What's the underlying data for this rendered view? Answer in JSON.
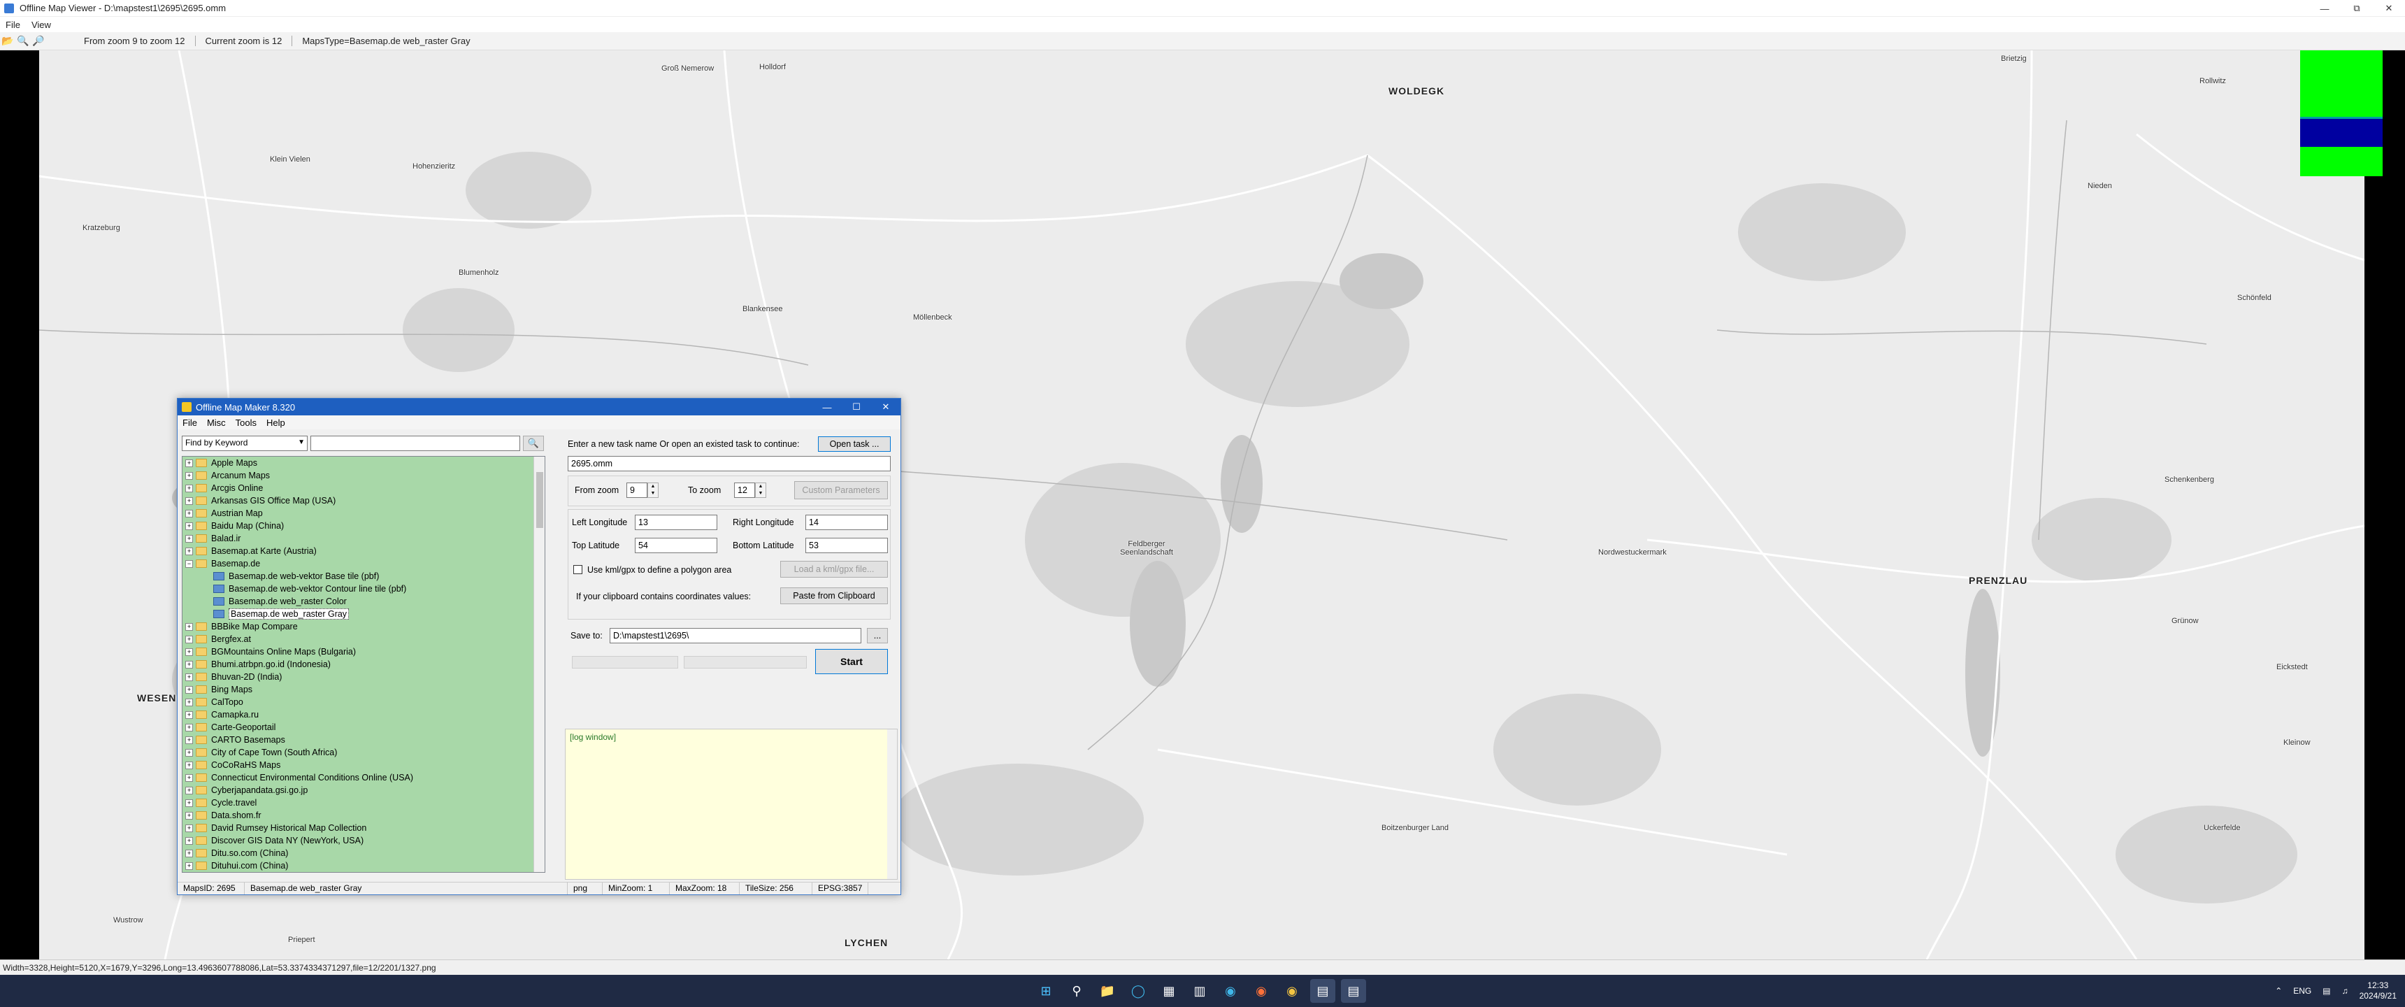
{
  "viewer": {
    "title": "Offline Map Viewer - D:\\mapstest1\\2695\\2695.omm",
    "menu": [
      "File",
      "View"
    ],
    "toolbar": {
      "zoom_range": "From zoom 9 to zoom 12",
      "current_zoom": "Current zoom is 12",
      "maps_type": "MapsType=Basemap.de web_raster Gray"
    },
    "status": "Width=3328,Height=5120,X=1679,Y=3296,Long=13.4963607788086,Lat=53.3374334371297,file=12/2201/1327.png",
    "colors": {
      "indicator_green": "#00ff00",
      "indicator_blue": "#0000a0"
    }
  },
  "map": {
    "places": [
      {
        "name": "WOLDEGK",
        "big": true
      },
      {
        "name": "PRENZLAU",
        "big": true
      },
      {
        "name": "WESENBERG",
        "big": true
      },
      {
        "name": "LYCHEN",
        "big": true
      },
      {
        "name": "Groß Nemerow",
        "big": false
      },
      {
        "name": "Holldorf",
        "big": false
      },
      {
        "name": "Kratzeburg",
        "big": false
      },
      {
        "name": "Klein Vielen",
        "big": false
      },
      {
        "name": "Hohenzieritz",
        "big": false
      },
      {
        "name": "Blumenholz",
        "big": false
      },
      {
        "name": "Blankensee",
        "big": false
      },
      {
        "name": "Möllenbeck",
        "big": false
      },
      {
        "name": "Feldberger Seenlandschaft",
        "big": false
      },
      {
        "name": "Nordwestuckermark",
        "big": false
      },
      {
        "name": "Boitzenburger Land",
        "big": false
      },
      {
        "name": "Wustrow",
        "big": false
      },
      {
        "name": "Priepert",
        "big": false
      },
      {
        "name": "Brietzig",
        "big": false
      },
      {
        "name": "Rollwitz",
        "big": false
      },
      {
        "name": "Nieden",
        "big": false
      },
      {
        "name": "Schönfeld",
        "big": false
      },
      {
        "name": "Schenkenberg",
        "big": false
      },
      {
        "name": "Grünow",
        "big": false
      },
      {
        "name": "Eickstedt",
        "big": false
      },
      {
        "name": "Uckerfelde",
        "big": false
      },
      {
        "name": "Kleinow",
        "big": false
      }
    ]
  },
  "dialog": {
    "title": "Offline Map Maker 8.320",
    "menu": [
      "File",
      "Misc",
      "Tools",
      "Help"
    ],
    "find": {
      "mode": "Find by Keyword",
      "query": ""
    },
    "tree": [
      {
        "label": "Apple Maps",
        "expanded": false
      },
      {
        "label": "Arcanum Maps",
        "expanded": false
      },
      {
        "label": "Arcgis Online",
        "expanded": false
      },
      {
        "label": "Arkansas GIS Office Map (USA)",
        "expanded": false
      },
      {
        "label": "Austrian Map",
        "expanded": false
      },
      {
        "label": "Baidu Map (China)",
        "expanded": false
      },
      {
        "label": "Balad.ir",
        "expanded": false
      },
      {
        "label": "Basemap.at Karte (Austria)",
        "expanded": false
      },
      {
        "label": "Basemap.de",
        "expanded": true,
        "children": [
          {
            "label": "Basemap.de web-vektor Base tile (pbf)"
          },
          {
            "label": "Basemap.de web-vektor Contour line tile (pbf)"
          },
          {
            "label": "Basemap.de web_raster Color"
          },
          {
            "label": "Basemap.de web_raster Gray",
            "selected": true
          }
        ]
      },
      {
        "label": "BBBike Map Compare",
        "expanded": false
      },
      {
        "label": "Bergfex.at",
        "expanded": false
      },
      {
        "label": "BGMountains Online Maps (Bulgaria)",
        "expanded": false
      },
      {
        "label": "Bhumi.atrbpn.go.id (Indonesia)",
        "expanded": false
      },
      {
        "label": "Bhuvan-2D (India)",
        "expanded": false
      },
      {
        "label": "Bing Maps",
        "expanded": false
      },
      {
        "label": "CalTopo",
        "expanded": false
      },
      {
        "label": "Camapka.ru",
        "expanded": false
      },
      {
        "label": "Carte-Geoportail",
        "expanded": false
      },
      {
        "label": "CARTO Basemaps",
        "expanded": false
      },
      {
        "label": "City of Cape Town (South Africa)",
        "expanded": false
      },
      {
        "label": "CoCoRaHS Maps",
        "expanded": false
      },
      {
        "label": "Connecticut Environmental Conditions Online (USA)",
        "expanded": false
      },
      {
        "label": "Cyberjapandata.gsi.go.jp",
        "expanded": false
      },
      {
        "label": "Cycle.travel",
        "expanded": false
      },
      {
        "label": "Data.shom.fr",
        "expanded": false
      },
      {
        "label": "David Rumsey Historical Map Collection",
        "expanded": false
      },
      {
        "label": "Discover GIS Data NY (NewYork, USA)",
        "expanded": false
      },
      {
        "label": "Ditu.so.com (China)",
        "expanded": false
      },
      {
        "label": "Dituhui.com (China)",
        "expanded": false
      }
    ],
    "task_prompt": "Enter a new task name Or open an existed task to continue:",
    "open_task_label": "Open task ...",
    "task_name": "2695.omm",
    "from_zoom_label": "From zoom",
    "from_zoom": "9",
    "to_zoom_label": "To zoom",
    "to_zoom": "12",
    "custom_params_label": "Custom Parameters",
    "left_lon_label": "Left Longitude",
    "left_lon": "13",
    "right_lon_label": "Right Longitude",
    "right_lon": "14",
    "top_lat_label": "Top Latitude",
    "top_lat": "54",
    "bottom_lat_label": "Bottom Latitude",
    "bottom_lat": "53",
    "kml_label": "Use kml/gpx to define a polygon area",
    "load_kml_label": "Load a kml/gpx file...",
    "clipboard_label": "If your clipboard contains coordinates values:",
    "paste_label": "Paste from Clipboard",
    "save_to_label": "Save to:",
    "save_path": "D:\\mapstest1\\2695\\",
    "browse_label": "...",
    "start_label": "Start",
    "log_label": "[log window]",
    "status": {
      "maps_id": "MapsID: 2695",
      "maps_name": "Basemap.de web_raster Gray",
      "format": "png",
      "min_zoom": "MinZoom: 1",
      "max_zoom": "MaxZoom: 18",
      "tile_size": "TileSize: 256",
      "epsg": "EPSG:3857"
    }
  },
  "taskbar": {
    "lang": "ENG",
    "time": "12:33",
    "date": "2024/9/21"
  }
}
